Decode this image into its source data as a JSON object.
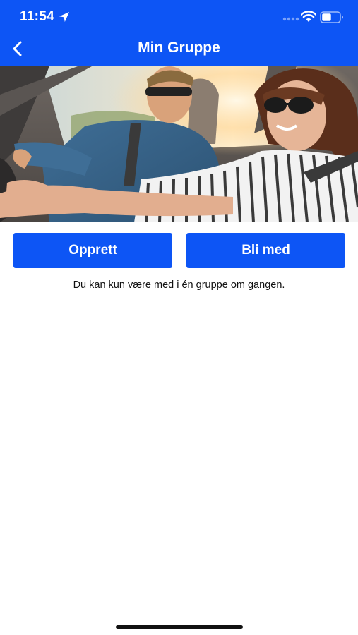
{
  "status_bar": {
    "time": "11:54",
    "icons": [
      "location-arrow-icon",
      "cellular-signal-icon",
      "wifi-icon",
      "battery-icon"
    ]
  },
  "nav": {
    "title": "Min Gruppe",
    "back_icon": "chevron-left-icon"
  },
  "hero": {
    "image": "couple-driving-car-photo"
  },
  "actions": {
    "create_label": "Opprett",
    "join_label": "Bli med"
  },
  "info": {
    "text": "Du kan kun være med i én gruppe om gangen."
  },
  "colors": {
    "primary": "#0d55f5",
    "background": "#ffffff",
    "text": "#111111"
  }
}
